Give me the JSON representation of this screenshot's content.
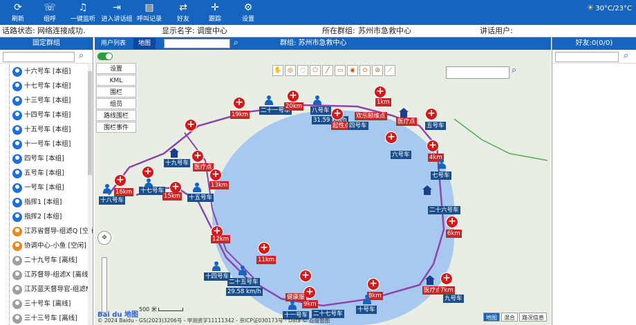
{
  "toolbar": {
    "buttons": [
      {
        "label": "刷新",
        "icon": "refresh-icon"
      },
      {
        "label": "组呼",
        "icon": "group-call-icon"
      },
      {
        "label": "一键监听",
        "icon": "headset-icon"
      },
      {
        "label": "进入讲话组",
        "icon": "enter-group-icon"
      },
      {
        "label": "呼叫记录",
        "icon": "call-record-icon"
      },
      {
        "label": "好友",
        "icon": "friend-icon"
      },
      {
        "label": "跟踪",
        "icon": "track-icon"
      },
      {
        "label": "设置",
        "icon": "settings-icon"
      }
    ],
    "weather": "30°C/23°C"
  },
  "status": {
    "link_label": "话路状态:",
    "link_value": "网络连接成功.",
    "display_label": "显示名字:",
    "display_value": "调度中心",
    "group_label": "所在群组:",
    "group_value": "苏州市急救中心",
    "speaker_label": "讲话用户:",
    "speaker_value": ""
  },
  "left_panel": {
    "title": "固定群组",
    "search_placeholder": "",
    "items": [
      {
        "label": "十六号车 [本组]",
        "color": "blue"
      },
      {
        "label": "十七号车 [本组]",
        "color": "blue"
      },
      {
        "label": "十三号车 [本组]",
        "color": "blue"
      },
      {
        "label": "十四号车 [本组]",
        "color": "blue"
      },
      {
        "label": "十五号车 [本组]",
        "color": "blue"
      },
      {
        "label": "十一号车 [本组]",
        "color": "blue"
      },
      {
        "label": "四号车 [本组]",
        "color": "blue"
      },
      {
        "label": "五号车 [本组]",
        "color": "blue"
      },
      {
        "label": "一号车 [本组]",
        "color": "blue"
      },
      {
        "label": "指挥1 [本组]",
        "color": "blue"
      },
      {
        "label": "指挥2 [本组]",
        "color": "blue"
      },
      {
        "label": "江苏省督导-组滤Q [空闲]",
        "color": "orange"
      },
      {
        "label": "协调中心-小鱼 [空闲]",
        "color": "orange"
      },
      {
        "label": "二十九号车 [离线]",
        "color": "gray"
      },
      {
        "label": "江苏督导-组滤X [离线]",
        "color": "gray"
      },
      {
        "label": "江苏蓝天督导官-组滤M",
        "color": "gray"
      },
      {
        "label": "三十号车 [离线]",
        "color": "gray"
      },
      {
        "label": "三十三号车 [离线]",
        "color": "gray"
      }
    ]
  },
  "map": {
    "tabs": [
      "用户列表",
      "地图"
    ],
    "group_label": "群组: 苏州市急救中心",
    "side_menu": [
      "设置",
      "KML",
      "围栏",
      "组员",
      "路线围栏",
      "围栏事件"
    ],
    "vehicles": [
      {
        "label": "十八号车",
        "kind": "blue"
      },
      {
        "label": "十七号车",
        "kind": "blue"
      },
      {
        "label": "十九号车",
        "kind": "blue"
      },
      {
        "label": "十五号车",
        "kind": "blue"
      },
      {
        "label": "十四号车",
        "kind": "blue"
      },
      {
        "label": "二十五号车",
        "kind": "blue"
      },
      {
        "label": "十一号车",
        "kind": "blue"
      },
      {
        "label": "二十七号车",
        "kind": "blue"
      },
      {
        "label": "十号车",
        "kind": "blue"
      },
      {
        "label": "九号车",
        "kind": "blue"
      },
      {
        "label": "二十六号车",
        "kind": "blue"
      },
      {
        "label": "七号车",
        "kind": "blue"
      },
      {
        "label": "六号车",
        "kind": "blue"
      },
      {
        "label": "五号车",
        "kind": "blue"
      },
      {
        "label": "八号车",
        "kind": "blue"
      },
      {
        "label": "四号车",
        "kind": "blue"
      },
      {
        "label": "二十一号车",
        "kind": "blue"
      },
      {
        "label": "16km",
        "kind": "red"
      },
      {
        "label": "15km",
        "kind": "red"
      },
      {
        "label": "13km",
        "kind": "red"
      },
      {
        "label": "12km",
        "kind": "red"
      },
      {
        "label": "11km",
        "kind": "red"
      },
      {
        "label": "19km",
        "kind": "red"
      },
      {
        "label": "20km",
        "kind": "red"
      },
      {
        "label": "1km",
        "kind": "red"
      },
      {
        "label": "4km",
        "kind": "red"
      },
      {
        "label": "6km",
        "kind": "red"
      },
      {
        "label": "7km",
        "kind": "red"
      },
      {
        "label": "8km",
        "kind": "red"
      },
      {
        "label": "9km",
        "kind": "red"
      },
      {
        "label": "医疗点",
        "kind": "red"
      },
      {
        "label": "欢乐颐维点",
        "kind": "red"
      },
      {
        "label": "起性点",
        "kind": "red"
      },
      {
        "label": "健康服",
        "kind": "red"
      },
      {
        "label": "31.59 km/h",
        "kind": "blue"
      },
      {
        "label": "29.58 km/h",
        "kind": "blue"
      }
    ],
    "scale": "500 米",
    "copyright": "© 2024 Baidu - GS(2023)3206号 - 甲测资字11111342 - 京ICP证030173号 - Data © 百度智图",
    "map_types": [
      "地图",
      "混合",
      "路况信息"
    ],
    "logo": "Bai du 地图"
  },
  "right_panel": {
    "title": "好友:0(0/0)"
  }
}
